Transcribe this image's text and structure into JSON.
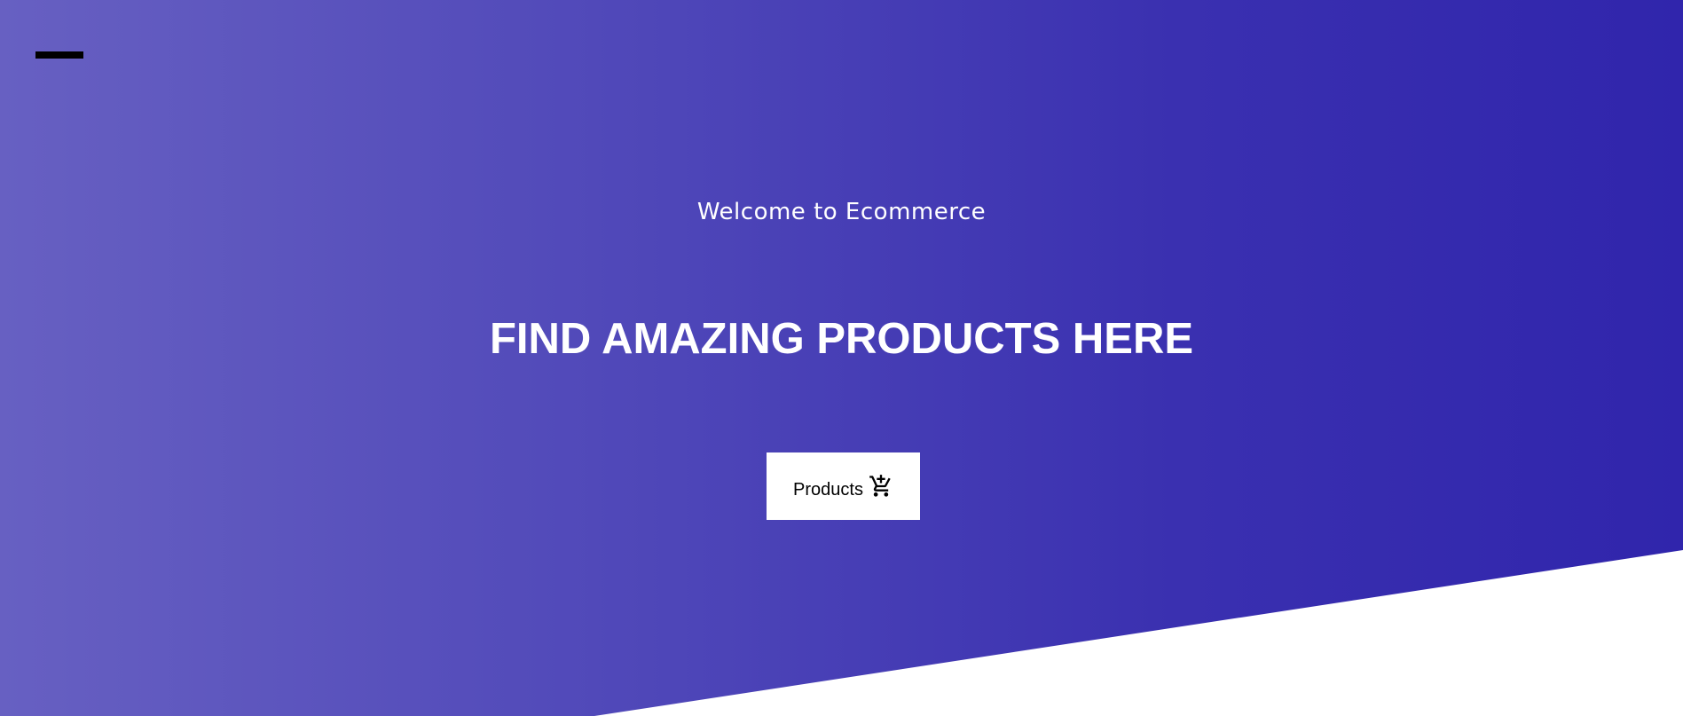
{
  "hero": {
    "welcome_text": "Welcome to Ecommerce",
    "headline": "FIND AMAZING PRODUCTS HERE",
    "cta_label": "Products",
    "cta_icon": "add-shopping-cart-icon",
    "menu_icon": "menu-icon"
  },
  "colors": {
    "gradient_start": "#6760c2",
    "gradient_end": "#3025ac",
    "text": "#ffffff",
    "button_bg": "#ffffff",
    "button_text": "#000000"
  }
}
